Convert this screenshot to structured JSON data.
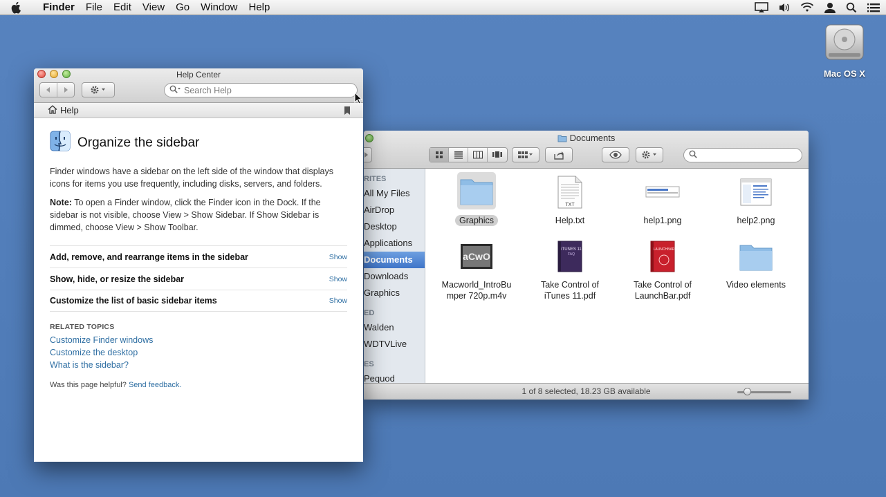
{
  "menubar": {
    "app_name": "Finder",
    "items": [
      "File",
      "Edit",
      "View",
      "Go",
      "Window",
      "Help"
    ]
  },
  "desktop": {
    "drive_label": "Mac OS X"
  },
  "help_window": {
    "title": "Help Center",
    "search_placeholder": "Search Help",
    "nav_home": "Help",
    "heading": "Organize the sidebar",
    "intro": "Finder windows have a sidebar on the left side of the window that displays icons for items you use frequently, including disks, servers, and folders.",
    "note_label": "Note:",
    "note_text": " To open a Finder window, click the Finder icon in the Dock. If the sidebar is not visible, choose View > Show Sidebar. If Show Sidebar is dimmed, choose View > Show Toolbar.",
    "tasks": [
      {
        "title": "Add, remove, and rearrange items in the sidebar",
        "action": "Show"
      },
      {
        "title": "Show, hide, or resize the sidebar",
        "action": "Show"
      },
      {
        "title": "Customize the list of basic sidebar items",
        "action": "Show"
      }
    ],
    "related_heading": "RELATED TOPICS",
    "related_links": [
      "Customize Finder windows",
      "Customize the desktop",
      "What is the sidebar?"
    ],
    "feedback_question": "Was this page helpful?",
    "feedback_link": "Send feedback."
  },
  "finder_window": {
    "title": "Documents",
    "sidebar": {
      "favorites_heading": "RITES",
      "favorites": [
        "All My Files",
        "AirDrop",
        "Desktop",
        "Applications",
        "Documents",
        "Downloads",
        "Graphics"
      ],
      "selected": "Documents",
      "shared_heading": "ED",
      "shared": [
        "Walden",
        "WDTVLive"
      ],
      "devices_heading": "ES",
      "devices": [
        "Pequod"
      ]
    },
    "files": [
      {
        "name": "Graphics",
        "kind": "folder",
        "selected": true
      },
      {
        "name": "Help.txt",
        "kind": "text"
      },
      {
        "name": "help1.png",
        "kind": "image"
      },
      {
        "name": "help2.png",
        "kind": "image"
      },
      {
        "name": "Macworld_IntroBumper 720p.m4v",
        "name_line1": "Macworld_IntroBu",
        "name_line2": "mper 720p.m4v",
        "kind": "video"
      },
      {
        "name": "Take Control of iTunes 11.pdf",
        "name_line1": "Take Control of",
        "name_line2": "iTunes 11.pdf",
        "kind": "pdf"
      },
      {
        "name": "Take Control of LaunchBar.pdf",
        "name_line1": "Take Control of",
        "name_line2": "LaunchBar.pdf",
        "kind": "pdf"
      },
      {
        "name": "Video elements",
        "kind": "folder"
      }
    ],
    "status": "1 of 8 selected, 18.23 GB available",
    "icon_size": 0.1
  }
}
